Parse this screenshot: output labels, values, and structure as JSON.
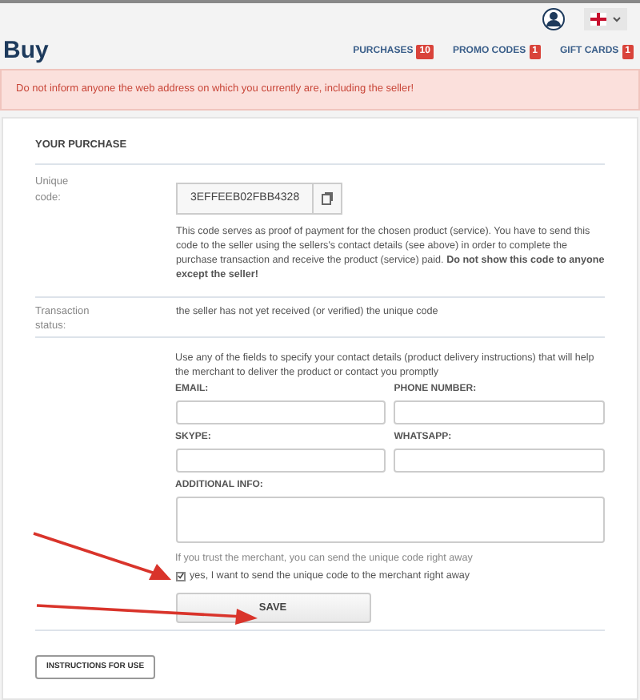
{
  "header": {
    "title": "Buy",
    "nav": [
      {
        "label": "PURCHASES",
        "count": "10"
      },
      {
        "label": "PROMO CODES",
        "count": "1"
      },
      {
        "label": "GIFT CARDS",
        "count": "1"
      }
    ]
  },
  "alert": "Do not inform anyone the web address on which you currently are, including the seller!",
  "purchase": {
    "heading": "YOUR PURCHASE",
    "code_label": "Unique code:",
    "code": "3EFFEEB02FBB4328",
    "code_note": "This code serves as proof of payment for the chosen product (service). You have to send this code to the seller using the sellers's contact details (see above) in order to complete the purchase transaction and receive the product (service) paid. **Do not show this code to anyone except the seller!**",
    "status_label": "Transaction status:",
    "status": "the seller has not yet received (or verified) the unique code",
    "contact_intro": "Use any of the fields to specify your contact details (product delivery instructions) that will help the merchant to deliver the product or contact you promptly",
    "fields": [
      {
        "label": "EMAIL:"
      },
      {
        "label": "PHONE NUMBER:"
      },
      {
        "label": "SKYPE:"
      },
      {
        "label": "WHATSAPP:"
      }
    ],
    "additional_label": "ADDITIONAL INFO:",
    "trust_note": "If you trust the merchant, you can send the unique code right away",
    "send_now": {
      "label": "yes, I want to send the unique code to the merchant right away",
      "checked": true
    },
    "save": "SAVE",
    "instructions": "INSTRUCTIONS FOR USE"
  }
}
